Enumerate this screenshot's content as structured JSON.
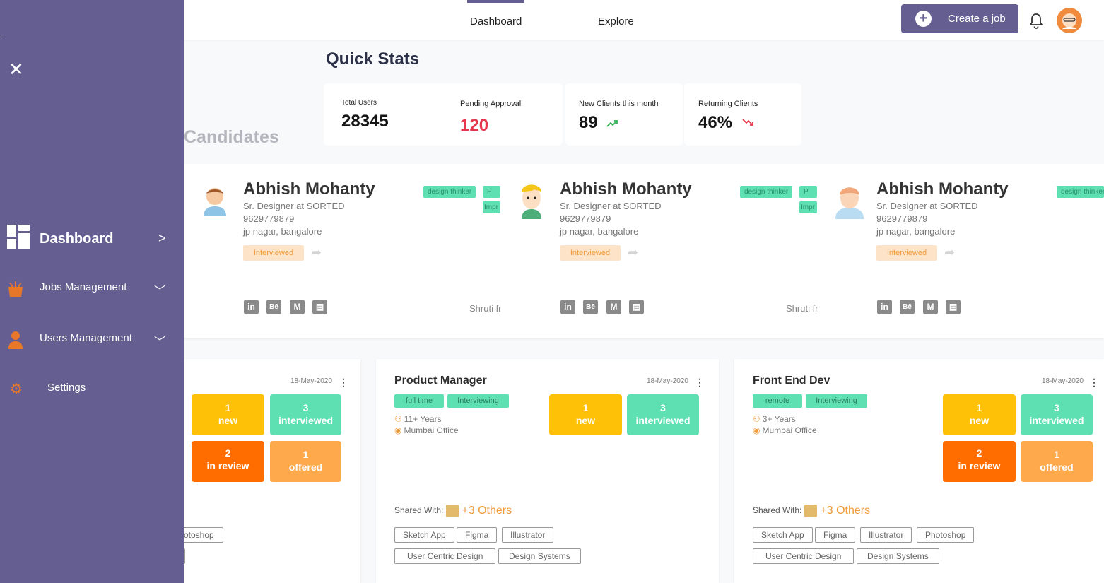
{
  "topbar": {
    "tabs": [
      {
        "label": "Dashboard",
        "active": true
      },
      {
        "label": "Explore",
        "active": false
      }
    ],
    "create_label": "Create a job",
    "accent": "#645e91"
  },
  "sidebar": {
    "items": [
      {
        "label": "Dashboard",
        "icon": "dashboard-icon",
        "expand": ">"
      },
      {
        "label": "Jobs Management",
        "icon": "jobs-icon",
        "expand": "﹀"
      },
      {
        "label": "Users Management",
        "icon": "user-icon",
        "expand": "﹀"
      },
      {
        "label": "Settings",
        "icon": "gear-icon"
      }
    ]
  },
  "quick_stats": {
    "title": "Quick Stats",
    "items": [
      {
        "label": "Total Users",
        "value": "28345"
      },
      {
        "label": "Pending Approval",
        "value": "120"
      },
      {
        "label": "New Clients this month",
        "value": "89",
        "trend": "up"
      },
      {
        "label": "Returning Clients",
        "value": "46%",
        "trend": "down"
      }
    ]
  },
  "candidates": {
    "title": "Candidates",
    "cards": [
      {
        "name": "Abhish Mohanty",
        "role": "Sr. Designer at SORTED",
        "phone": "9629779879",
        "location": "jp nagar, bangalore",
        "status": "Interviewed",
        "tags": [
          "design thinker",
          "P",
          "Impr"
        ],
        "referral": "Shruti fr"
      },
      {
        "name": "Abhish Mohanty",
        "role": "Sr. Designer at SORTED",
        "phone": "9629779879",
        "location": "jp nagar, bangalore",
        "status": "Interviewed",
        "tags": [
          "design thinker",
          "P",
          "Impr"
        ],
        "referral": "Shruti fr"
      },
      {
        "name": "Abhish Mohanty",
        "role": "Sr. Designer at SORTED",
        "phone": "9629779879",
        "location": "jp nagar, bangalore",
        "status": "Interviewed",
        "tags": [
          "design thinker"
        ],
        "referral": ""
      }
    ],
    "social": [
      "in",
      "Bē",
      "M",
      "▤"
    ]
  },
  "jobs": [
    {
      "title": "",
      "date": "18-May-2020",
      "tags": [],
      "experience": "",
      "location": "",
      "counts": {
        "new": "1",
        "new_label": "new",
        "interviewed": "3",
        "interviewed_label": "interviewed",
        "review": "2",
        "review_label": "in review",
        "offered": "1",
        "offered_label": "offered"
      },
      "shared_label": "",
      "others": "",
      "skills": [
        "otoshop",
        ""
      ]
    },
    {
      "title": "Product Manager",
      "date": "18-May-2020",
      "tags": [
        "full time",
        "Interviewing"
      ],
      "experience": "11+ Years",
      "location": "Mumbai Office",
      "counts": {
        "new": "1",
        "new_label": "new",
        "interviewed": "3",
        "interviewed_label": "interviewed"
      },
      "shared_label": "Shared With:",
      "others": "+3 Others",
      "skills": [
        "Sketch App",
        "Figma",
        "Illustrator",
        "User Centric Design",
        "Design Systems"
      ]
    },
    {
      "title": "Front End Dev",
      "date": "18-May-2020",
      "tags": [
        "remote",
        "Interviewing"
      ],
      "experience": "3+ Years",
      "location": "Mumbai Office",
      "counts": {
        "new": "1",
        "new_label": "new",
        "interviewed": "3",
        "interviewed_label": "interviewed",
        "review": "2",
        "review_label": "in review",
        "offered": "1",
        "offered_label": "offered"
      },
      "shared_label": "Shared With:",
      "others": "+3 Others",
      "skills": [
        "Sketch App",
        "Figma",
        "Illustrator",
        "Photoshop",
        "User Centric Design",
        "Design Systems"
      ]
    }
  ]
}
